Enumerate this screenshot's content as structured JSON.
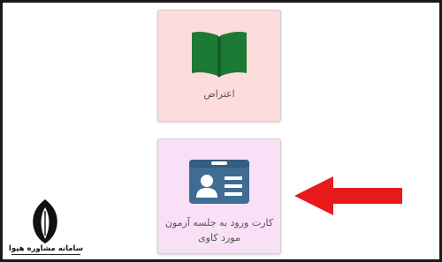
{
  "cards": [
    {
      "label": "اعتراض",
      "icon": "book-icon",
      "background": "#fddcdc"
    },
    {
      "label": "کارت ورود به جلسه آزمون مورد کاوی",
      "icon": "id-card-icon",
      "background": "#f8e0f6"
    }
  ],
  "annotation": {
    "icon": "red-arrow-icon",
    "color": "#e8191b"
  },
  "logo": {
    "text": "سامانه مشاوره هپوا"
  },
  "colors": {
    "book_green": "#1c7a35",
    "id_card_blue": "#3e6c93"
  }
}
